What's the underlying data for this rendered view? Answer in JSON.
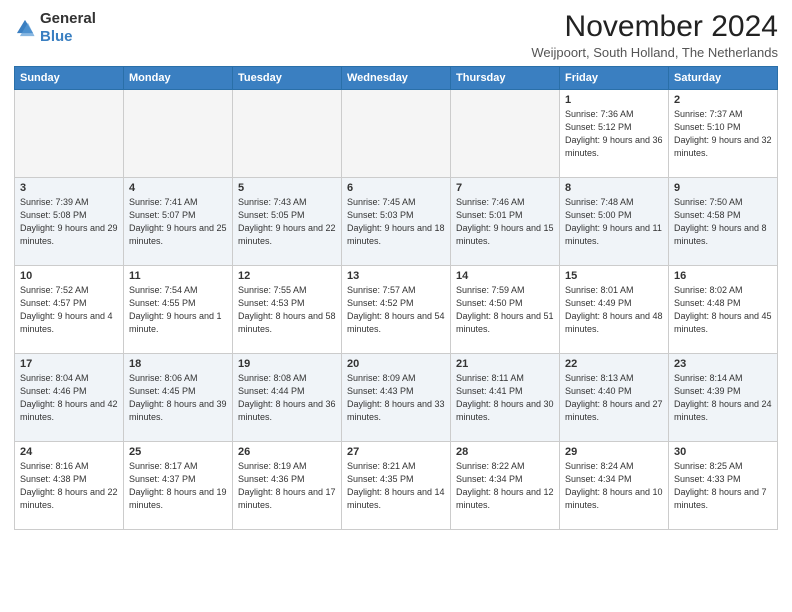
{
  "logo": {
    "general": "General",
    "blue": "Blue"
  },
  "title": "November 2024",
  "location": "Weijpoort, South Holland, The Netherlands",
  "weekdays": [
    "Sunday",
    "Monday",
    "Tuesday",
    "Wednesday",
    "Thursday",
    "Friday",
    "Saturday"
  ],
  "weeks": [
    [
      {
        "day": "",
        "info": ""
      },
      {
        "day": "",
        "info": ""
      },
      {
        "day": "",
        "info": ""
      },
      {
        "day": "",
        "info": ""
      },
      {
        "day": "",
        "info": ""
      },
      {
        "day": "1",
        "info": "Sunrise: 7:36 AM\nSunset: 5:12 PM\nDaylight: 9 hours and 36 minutes."
      },
      {
        "day": "2",
        "info": "Sunrise: 7:37 AM\nSunset: 5:10 PM\nDaylight: 9 hours and 32 minutes."
      }
    ],
    [
      {
        "day": "3",
        "info": "Sunrise: 7:39 AM\nSunset: 5:08 PM\nDaylight: 9 hours and 29 minutes."
      },
      {
        "day": "4",
        "info": "Sunrise: 7:41 AM\nSunset: 5:07 PM\nDaylight: 9 hours and 25 minutes."
      },
      {
        "day": "5",
        "info": "Sunrise: 7:43 AM\nSunset: 5:05 PM\nDaylight: 9 hours and 22 minutes."
      },
      {
        "day": "6",
        "info": "Sunrise: 7:45 AM\nSunset: 5:03 PM\nDaylight: 9 hours and 18 minutes."
      },
      {
        "day": "7",
        "info": "Sunrise: 7:46 AM\nSunset: 5:01 PM\nDaylight: 9 hours and 15 minutes."
      },
      {
        "day": "8",
        "info": "Sunrise: 7:48 AM\nSunset: 5:00 PM\nDaylight: 9 hours and 11 minutes."
      },
      {
        "day": "9",
        "info": "Sunrise: 7:50 AM\nSunset: 4:58 PM\nDaylight: 9 hours and 8 minutes."
      }
    ],
    [
      {
        "day": "10",
        "info": "Sunrise: 7:52 AM\nSunset: 4:57 PM\nDaylight: 9 hours and 4 minutes."
      },
      {
        "day": "11",
        "info": "Sunrise: 7:54 AM\nSunset: 4:55 PM\nDaylight: 9 hours and 1 minute."
      },
      {
        "day": "12",
        "info": "Sunrise: 7:55 AM\nSunset: 4:53 PM\nDaylight: 8 hours and 58 minutes."
      },
      {
        "day": "13",
        "info": "Sunrise: 7:57 AM\nSunset: 4:52 PM\nDaylight: 8 hours and 54 minutes."
      },
      {
        "day": "14",
        "info": "Sunrise: 7:59 AM\nSunset: 4:50 PM\nDaylight: 8 hours and 51 minutes."
      },
      {
        "day": "15",
        "info": "Sunrise: 8:01 AM\nSunset: 4:49 PM\nDaylight: 8 hours and 48 minutes."
      },
      {
        "day": "16",
        "info": "Sunrise: 8:02 AM\nSunset: 4:48 PM\nDaylight: 8 hours and 45 minutes."
      }
    ],
    [
      {
        "day": "17",
        "info": "Sunrise: 8:04 AM\nSunset: 4:46 PM\nDaylight: 8 hours and 42 minutes."
      },
      {
        "day": "18",
        "info": "Sunrise: 8:06 AM\nSunset: 4:45 PM\nDaylight: 8 hours and 39 minutes."
      },
      {
        "day": "19",
        "info": "Sunrise: 8:08 AM\nSunset: 4:44 PM\nDaylight: 8 hours and 36 minutes."
      },
      {
        "day": "20",
        "info": "Sunrise: 8:09 AM\nSunset: 4:43 PM\nDaylight: 8 hours and 33 minutes."
      },
      {
        "day": "21",
        "info": "Sunrise: 8:11 AM\nSunset: 4:41 PM\nDaylight: 8 hours and 30 minutes."
      },
      {
        "day": "22",
        "info": "Sunrise: 8:13 AM\nSunset: 4:40 PM\nDaylight: 8 hours and 27 minutes."
      },
      {
        "day": "23",
        "info": "Sunrise: 8:14 AM\nSunset: 4:39 PM\nDaylight: 8 hours and 24 minutes."
      }
    ],
    [
      {
        "day": "24",
        "info": "Sunrise: 8:16 AM\nSunset: 4:38 PM\nDaylight: 8 hours and 22 minutes."
      },
      {
        "day": "25",
        "info": "Sunrise: 8:17 AM\nSunset: 4:37 PM\nDaylight: 8 hours and 19 minutes."
      },
      {
        "day": "26",
        "info": "Sunrise: 8:19 AM\nSunset: 4:36 PM\nDaylight: 8 hours and 17 minutes."
      },
      {
        "day": "27",
        "info": "Sunrise: 8:21 AM\nSunset: 4:35 PM\nDaylight: 8 hours and 14 minutes."
      },
      {
        "day": "28",
        "info": "Sunrise: 8:22 AM\nSunset: 4:34 PM\nDaylight: 8 hours and 12 minutes."
      },
      {
        "day": "29",
        "info": "Sunrise: 8:24 AM\nSunset: 4:34 PM\nDaylight: 8 hours and 10 minutes."
      },
      {
        "day": "30",
        "info": "Sunrise: 8:25 AM\nSunset: 4:33 PM\nDaylight: 8 hours and 7 minutes."
      }
    ]
  ]
}
